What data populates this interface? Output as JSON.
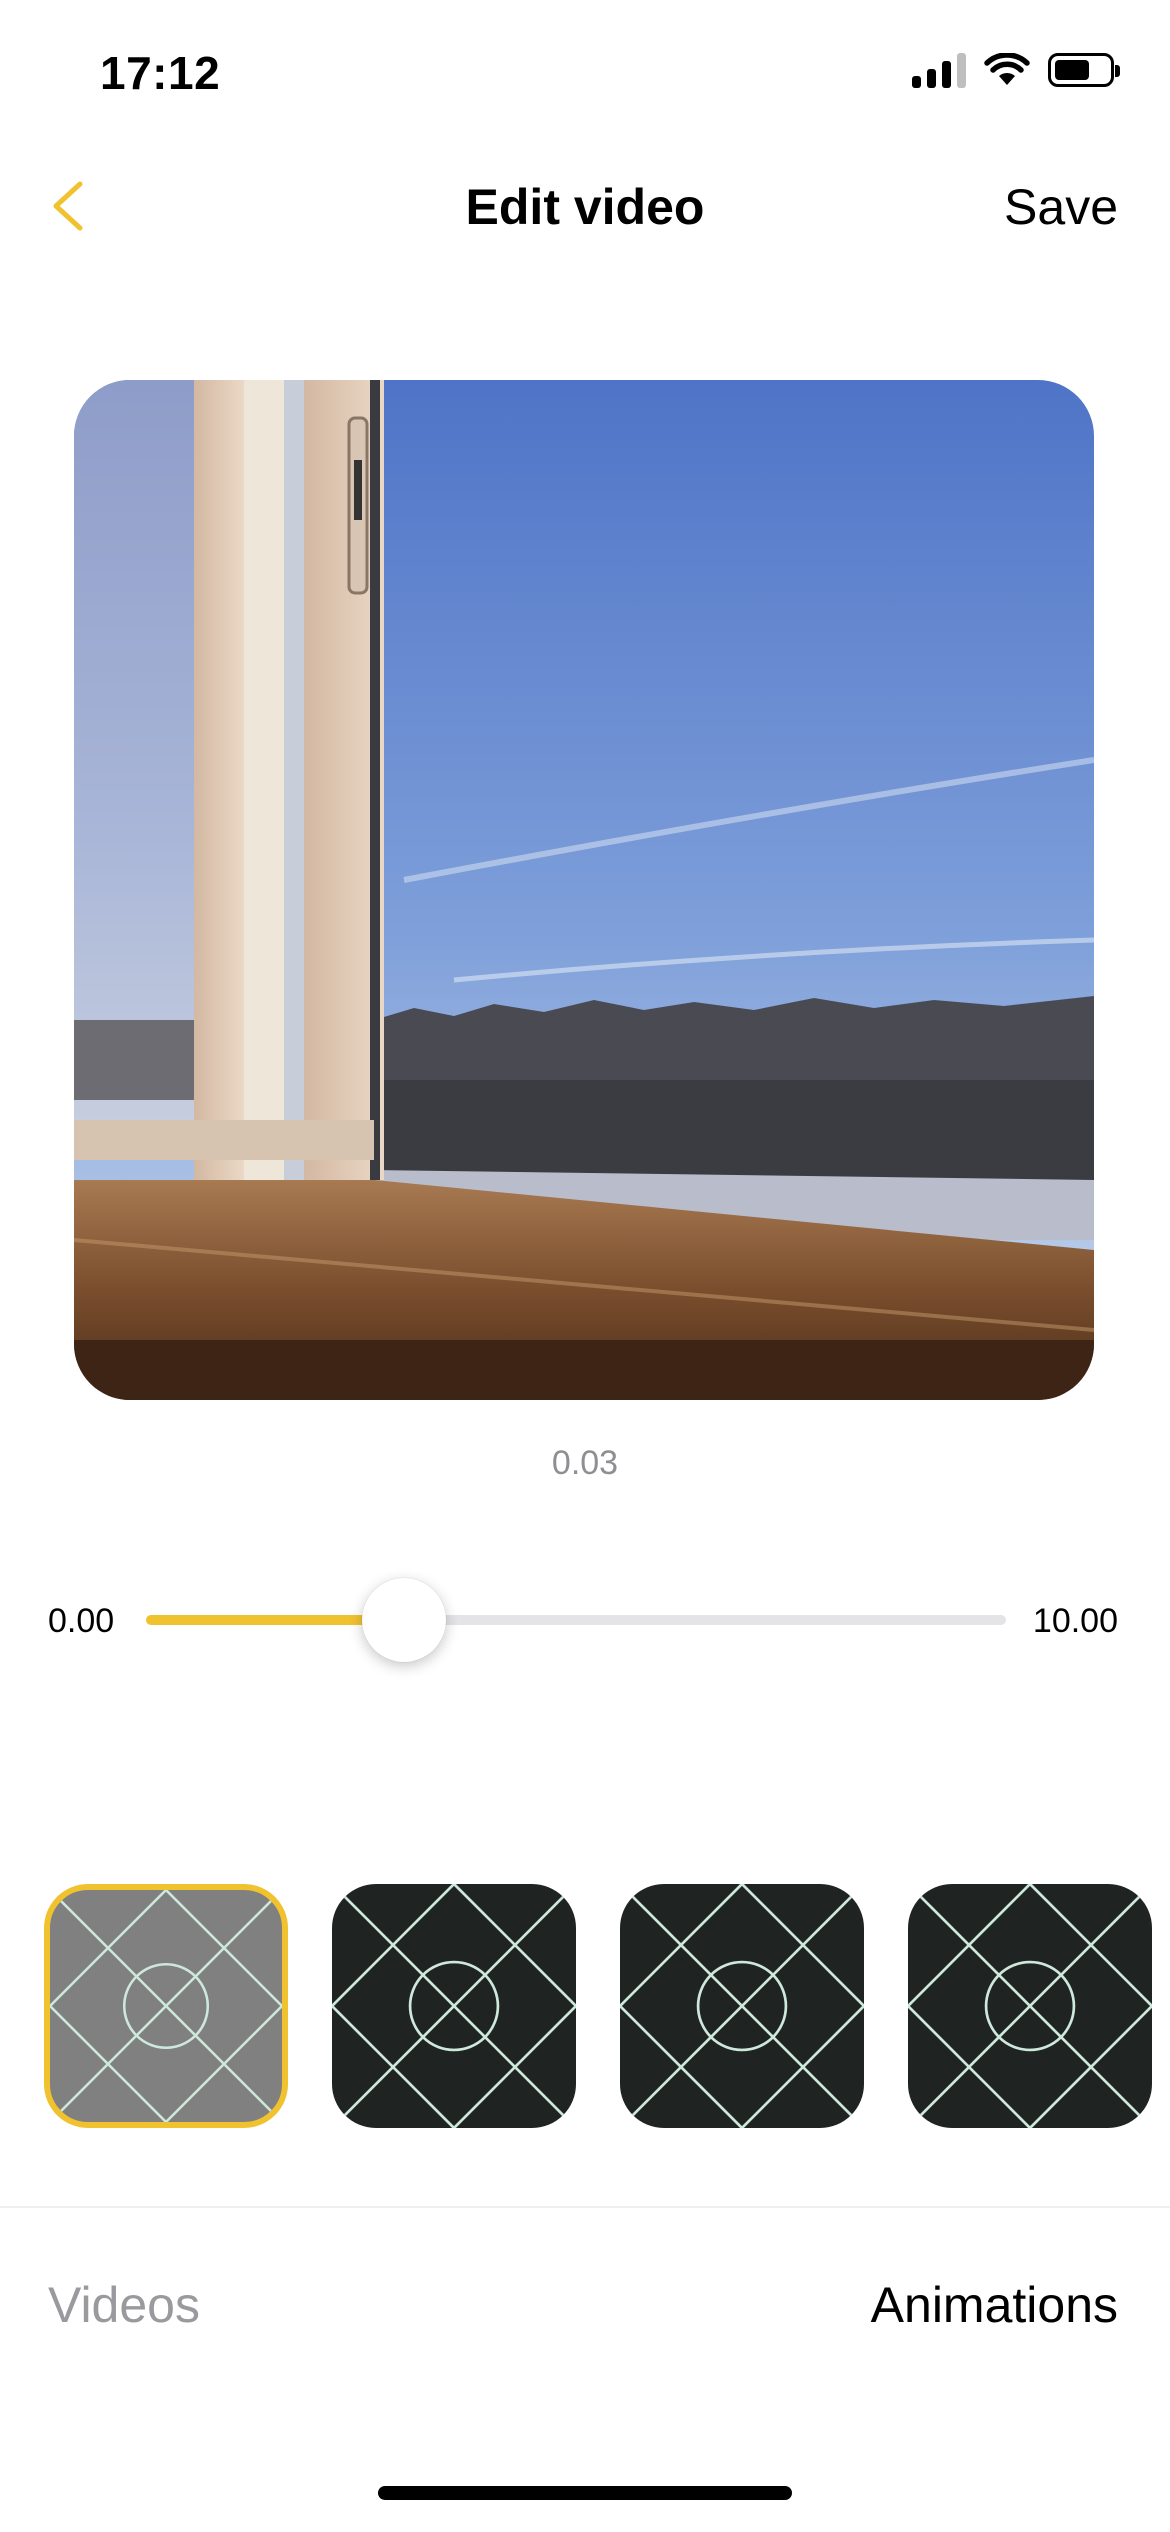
{
  "status_bar": {
    "time": "17:12",
    "icons": [
      "signal-icon",
      "wifi-icon",
      "battery-icon"
    ]
  },
  "nav": {
    "back_icon": "chevron-left-icon",
    "title": "Edit video",
    "save_label": "Save",
    "accent_color": "#F1C230"
  },
  "preview": {
    "current_time": "0.03"
  },
  "slider": {
    "min_label": "0.00",
    "max_label": "10.00",
    "value_fraction": 0.3,
    "fill_color": "#F1C230"
  },
  "thumbnails": [
    {
      "icon": "placeholder-grid-icon",
      "selected": true
    },
    {
      "icon": "placeholder-grid-icon",
      "selected": false
    },
    {
      "icon": "placeholder-grid-icon",
      "selected": false
    },
    {
      "icon": "placeholder-grid-icon",
      "selected": false
    }
  ],
  "tabs": {
    "videos": "Videos",
    "animations": "Animations",
    "active": "Animations"
  }
}
